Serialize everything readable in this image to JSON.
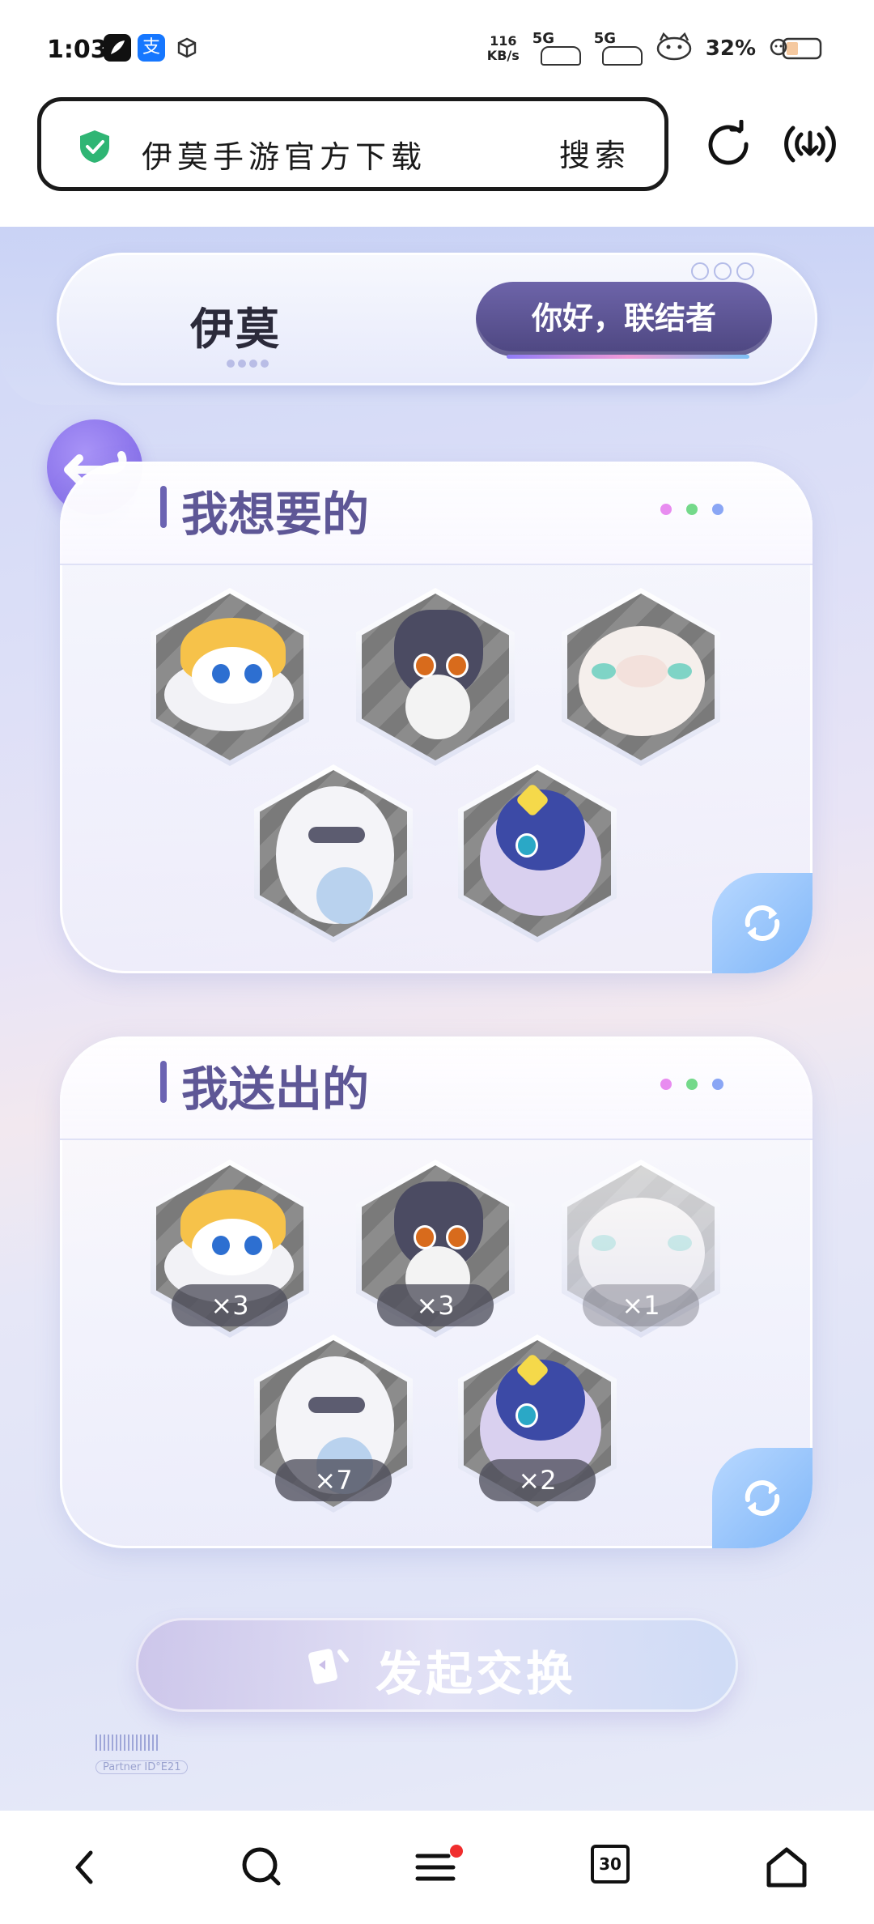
{
  "status_bar": {
    "time": "1:03",
    "net_speed_value": "116",
    "net_speed_unit": "KB/s",
    "sim1": "5G",
    "sim2": "5G",
    "battery": "32%",
    "app_icons": [
      "feather-app-icon",
      "alipay-icon",
      "cube-app-icon"
    ],
    "alipay_glyph": "支"
  },
  "browser": {
    "search_query": "伊莫手游官方下载",
    "search_button": "搜索",
    "shield_color": "#2fb574"
  },
  "header": {
    "logo": "伊莫",
    "greeting": "你好，联结者"
  },
  "want_card": {
    "title": "我想要的",
    "pets": [
      {
        "name": "orange-fox-pet"
      },
      {
        "name": "gray-wolf-pet"
      },
      {
        "name": "sheep-cloud-pet"
      },
      {
        "name": "white-bear-pet"
      },
      {
        "name": "blue-squirrel-pet"
      }
    ]
  },
  "give_card": {
    "title": "我送出的",
    "pets": [
      {
        "name": "orange-fox-pet",
        "count": "×3"
      },
      {
        "name": "gray-wolf-pet",
        "count": "×3"
      },
      {
        "name": "sheep-cloud-pet",
        "count": "×1"
      },
      {
        "name": "white-bear-pet",
        "count": "×7"
      },
      {
        "name": "blue-squirrel-pet",
        "count": "×2"
      }
    ]
  },
  "exchange_button": "发起交换",
  "footer": {
    "tag": "Partner ID°E21",
    "tabs_count": "30"
  },
  "colors": {
    "accent": "#5e5796",
    "greeting_bg": "#4d4680",
    "dot_pink": "#e88cf0",
    "dot_green": "#74d98a",
    "dot_blue": "#8aa6f5",
    "notification_badge": "#f02d2d"
  }
}
